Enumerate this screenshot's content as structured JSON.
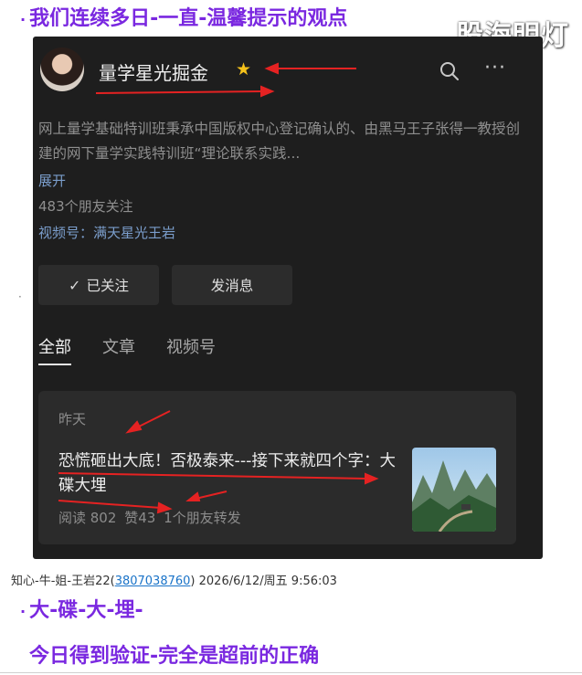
{
  "heading": "我们连续多日-一直-温馨提示的观点",
  "watermark": "股海明灯",
  "account": {
    "name": "量学星光掘金",
    "star_color": "#f5c21b",
    "description": "网上量学基础特训班秉承中国版权中心登记确认的、由黑马王子张得一教授创建的网下量学实践特训班“理论联系实践...",
    "expand_label": "展开",
    "followers": "483个朋友关注",
    "video_channel": "视频号：满天星光王岩"
  },
  "buttons": {
    "follow": "已关注",
    "message": "发消息"
  },
  "tabs": [
    "全部",
    "文章",
    "视频号"
  ],
  "post": {
    "date": "昨天",
    "title": "恐慌砸出大底！否极泰来---接下来就四个字：大碟大埋",
    "reads": "阅读 802",
    "likes": "赞43",
    "shares": "1个朋友转发"
  },
  "footer": {
    "author": "知心-牛-姐-王岩22(",
    "author_id": "3807038760",
    "author_close": ")",
    "datetime": "2026/6/12/周五 9:56:03"
  },
  "conclusion": {
    "line1": "大-碟-大-埋-",
    "line2": "今日得到验证-完全是超前的正确"
  },
  "colors": {
    "accent_purple": "#7a28e0",
    "panel_bg": "#1e1e1e",
    "arrow_red": "#e52222",
    "link_blue": "#7b9ecc"
  },
  "icons": {
    "search": "search-icon",
    "more": "more-icon",
    "star": "star-icon",
    "check": "check-icon"
  }
}
